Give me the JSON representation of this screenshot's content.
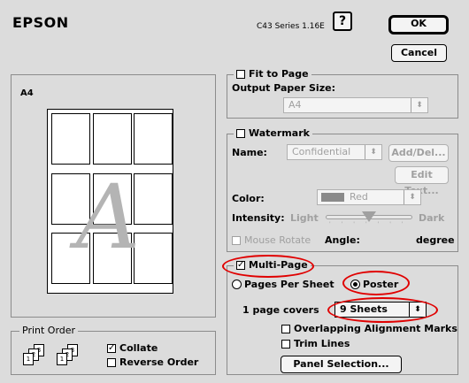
{
  "header": {
    "brand": "EPSON",
    "version": "C43 Series 1.16E",
    "help_label": "?",
    "ok_label": "OK",
    "cancel_label": "Cancel"
  },
  "preview": {
    "paper_label": "A4",
    "poster_letter": "A"
  },
  "print_order": {
    "title": "Print Order",
    "collate_label": "Collate",
    "collate_checked": true,
    "reverse_label": "Reverse Order",
    "reverse_checked": false,
    "doc_numbers": [
      "1",
      "2",
      "3"
    ]
  },
  "fit_to_page": {
    "label": "Fit to Page",
    "checked": false,
    "output_size_label": "Output Paper Size:",
    "output_size_value": "A4"
  },
  "watermark": {
    "label": "Watermark",
    "checked": false,
    "name_label": "Name:",
    "name_value": "Confidential",
    "add_del_label": "Add/Del...",
    "edit_text_label": "Edit Text...",
    "color_label": "Color:",
    "color_value": "Red",
    "swatch_color": "#8a8a8a",
    "intensity_label": "Intensity:",
    "intensity_light": "Light",
    "intensity_dark": "Dark",
    "intensity_level": 0.5,
    "mouse_rotate_label": "Mouse Rotate",
    "angle_label": "Angle:",
    "angle_unit": "degree"
  },
  "multi_page": {
    "label": "Multi-Page",
    "checked": true,
    "pages_per_sheet_label": "Pages Per Sheet",
    "poster_label": "Poster",
    "selected_mode": "Poster",
    "covers_label": "1 page covers",
    "covers_value": "9 Sheets",
    "overlap_label": "Overlapping Alignment Marks",
    "overlap_checked": false,
    "trim_label": "Trim Lines",
    "trim_checked": false,
    "panel_button_label": "Panel Selection..."
  },
  "colors": {
    "highlight_ring": "#e00000",
    "window_bg": "#dcdcdc"
  }
}
